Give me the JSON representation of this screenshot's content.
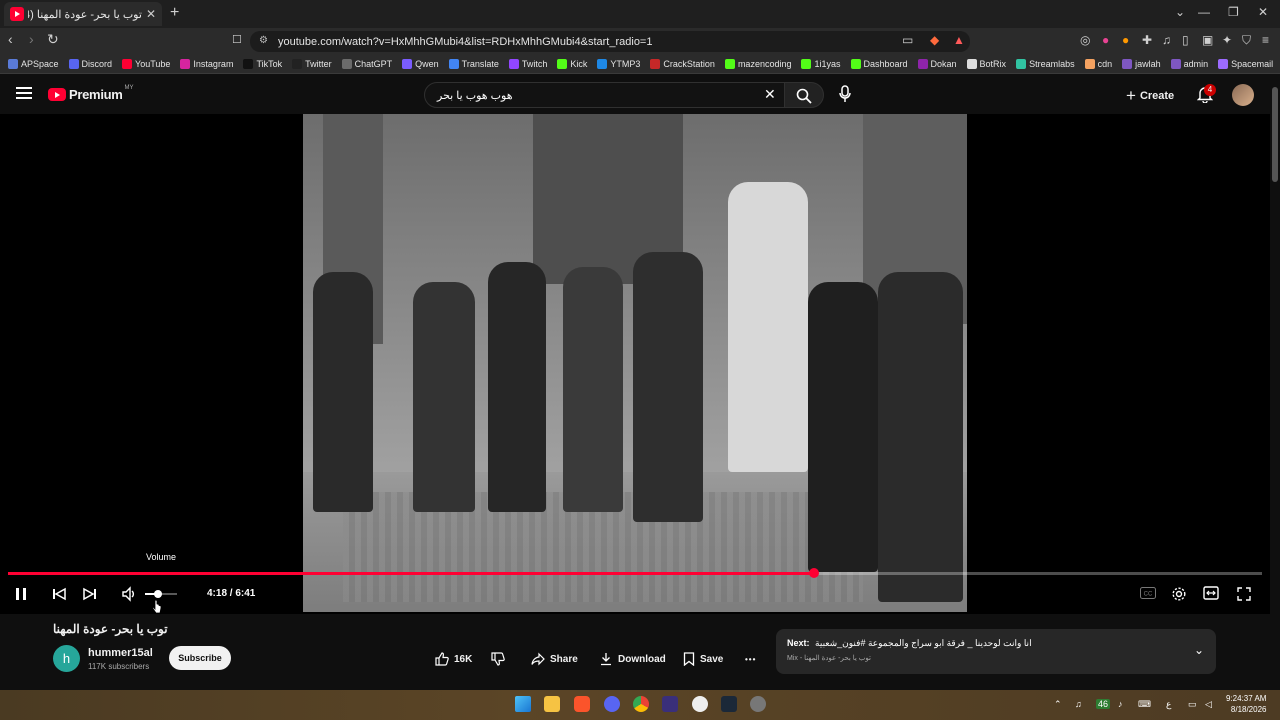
{
  "browser": {
    "tab_title": "توب يا بحر- عودة المهنا (4) ●",
    "tab_close": "✕",
    "new_tab": "+",
    "url": "youtube.com/watch?v=HxMhhGMubi4&list=RDHxMhhGMubi4&start_radio=1",
    "window_controls": [
      "⌄",
      "—",
      "❐",
      "✕"
    ]
  },
  "bookmarks": [
    {
      "label": "APSpace",
      "color": "#5a7bd8"
    },
    {
      "label": "Discord",
      "color": "#5865f2"
    },
    {
      "label": "YouTube",
      "color": "#ff0033"
    },
    {
      "label": "Instagram",
      "color": "#d6249f"
    },
    {
      "label": "TikTok",
      "color": "#111111"
    },
    {
      "label": "Twitter",
      "color": "#222222"
    },
    {
      "label": "ChatGPT",
      "color": "#6b6b6b"
    },
    {
      "label": "Qwen",
      "color": "#7a5cff"
    },
    {
      "label": "Translate",
      "color": "#4285f4"
    },
    {
      "label": "Twitch",
      "color": "#9146ff"
    },
    {
      "label": "Kick",
      "color": "#53fc18"
    },
    {
      "label": "YTMP3",
      "color": "#1e88e5"
    },
    {
      "label": "CrackStation",
      "color": "#c62828"
    },
    {
      "label": "mazencoding",
      "color": "#53fc18"
    },
    {
      "label": "1i1yas",
      "color": "#53fc18"
    },
    {
      "label": "Dashboard",
      "color": "#53fc18"
    },
    {
      "label": "Dokan",
      "color": "#8e24aa"
    },
    {
      "label": "BotRix",
      "color": "#dddddd"
    },
    {
      "label": "Streamlabs",
      "color": "#31c3a2"
    },
    {
      "label": "cdn",
      "color": "#f4a261"
    },
    {
      "label": "jawlah",
      "color": "#7e57c2"
    },
    {
      "label": "admin",
      "color": "#7e57c2"
    },
    {
      "label": "Spacemail",
      "color": "#9c6bff"
    }
  ],
  "youtube": {
    "logo_text": "Premium",
    "logo_region": "MY",
    "search_value": "هوب هوب يا بحر",
    "create_label": "Create",
    "notification_count": "4"
  },
  "player": {
    "volume_tooltip": "Volume",
    "time": "4:18 / 6:41",
    "progress_fraction": 0.643,
    "volume_fraction": 0.4,
    "accent": "#ff0033"
  },
  "video": {
    "title": "توب يا بحر- عودة المهنا",
    "channel_initial": "h",
    "channel_name": "hummer15al",
    "subscribers": "117K subscribers",
    "subscribe_label": "Subscribe",
    "likes": "16K",
    "share_label": "Share",
    "download_label": "Download",
    "save_label": "Save",
    "more_label": "•••"
  },
  "next": {
    "prefix": "Next:",
    "title": "انا وانت لوحدينا _ فرقة ابو سراج والمجموعة #فنون_شعبية",
    "sub": "Mix - توب يا بحر- عودة المهنا"
  },
  "taskbar": {
    "time": "9:24:37 AM",
    "date": "8/18/2026",
    "lang": "ع",
    "badge": "46"
  }
}
